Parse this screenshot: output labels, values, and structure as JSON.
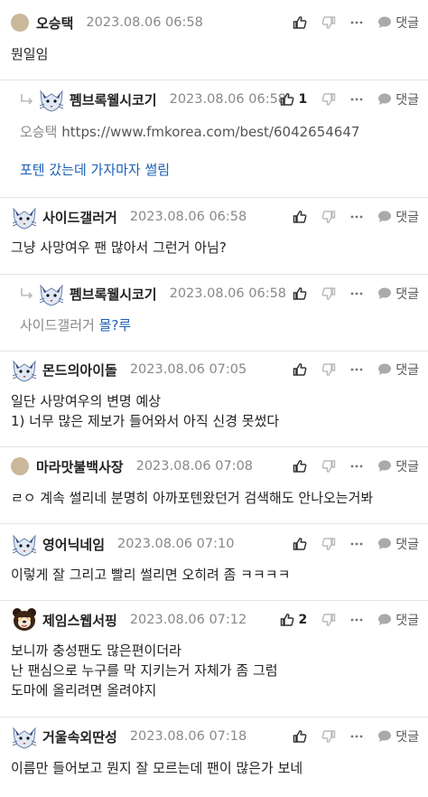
{
  "comments": [
    {
      "nick": "오승택",
      "date": "2023.08.06 06:58",
      "likes": "",
      "reply": "댓글",
      "avatar": "dot",
      "lines": [
        "뭔일임"
      ]
    },
    {
      "nick": "펨브록웰시코기",
      "date": "2023.08.06 06:58",
      "likes": "1",
      "reply": "댓글",
      "avatar": "fox",
      "is_reply": true,
      "mention": "오승택",
      "link": "https://www.fmkorea.com/best/6042654647",
      "extra": "포텐 갔는데 가자마자 썰림"
    },
    {
      "nick": "사이드갤러거",
      "date": "2023.08.06 06:58",
      "likes": "",
      "reply": "댓글",
      "avatar": "fox",
      "lines": [
        "그냥 사망여우 팬 많아서 그런거 아님?"
      ]
    },
    {
      "nick": "펨브록웰시코기",
      "date": "2023.08.06 06:58",
      "likes": "",
      "reply": "댓글",
      "avatar": "fox",
      "is_reply": true,
      "mention": "사이드갤러거",
      "text": "몰?루"
    },
    {
      "nick": "몬드의아이돌",
      "date": "2023.08.06 07:05",
      "likes": "",
      "reply": "댓글",
      "avatar": "fox",
      "lines": [
        "일단 사망여우의 변명 예상",
        "1) 너무 많은 제보가 들어와서 아직 신경 못썼다"
      ]
    },
    {
      "nick": "마라맛불백사장",
      "date": "2023.08.06 07:08",
      "likes": "",
      "reply": "댓글",
      "avatar": "dot",
      "lines": [
        "ㄹㅇ 계속 썰리네 분명히 아까포텐왔던거 검색해도 안나오는거봐"
      ]
    },
    {
      "nick": "영어닉네임",
      "date": "2023.08.06 07:10",
      "likes": "",
      "reply": "댓글",
      "avatar": "fox",
      "lines": [
        "이렇게 잘 그리고 빨리 썰리면 오히려 좀 ㅋㅋㅋㅋ"
      ]
    },
    {
      "nick": "제임스웹서핑",
      "date": "2023.08.06 07:12",
      "likes": "2",
      "reply": "댓글",
      "avatar": "bear",
      "lines": [
        "보니까 충성팬도 많은편이더라",
        "난 팬심으로 누구를 막 지키는거 자체가 좀 그럼",
        "도마에 올리려면 올려야지"
      ]
    },
    {
      "nick": "거울속외딴성",
      "date": "2023.08.06 07:18",
      "likes": "",
      "reply": "댓글",
      "avatar": "fox",
      "lines": [
        "이름만 들어보고 뭔지 잘 모르는데 팬이 많은가 보네"
      ]
    }
  ],
  "icons": {
    "like": "thumbs-up-icon",
    "dislike": "thumbs-down-icon",
    "more": "more-dots-icon",
    "reply": "speech-bubble-icon",
    "reply_arrow": "reply-arrow-icon"
  }
}
